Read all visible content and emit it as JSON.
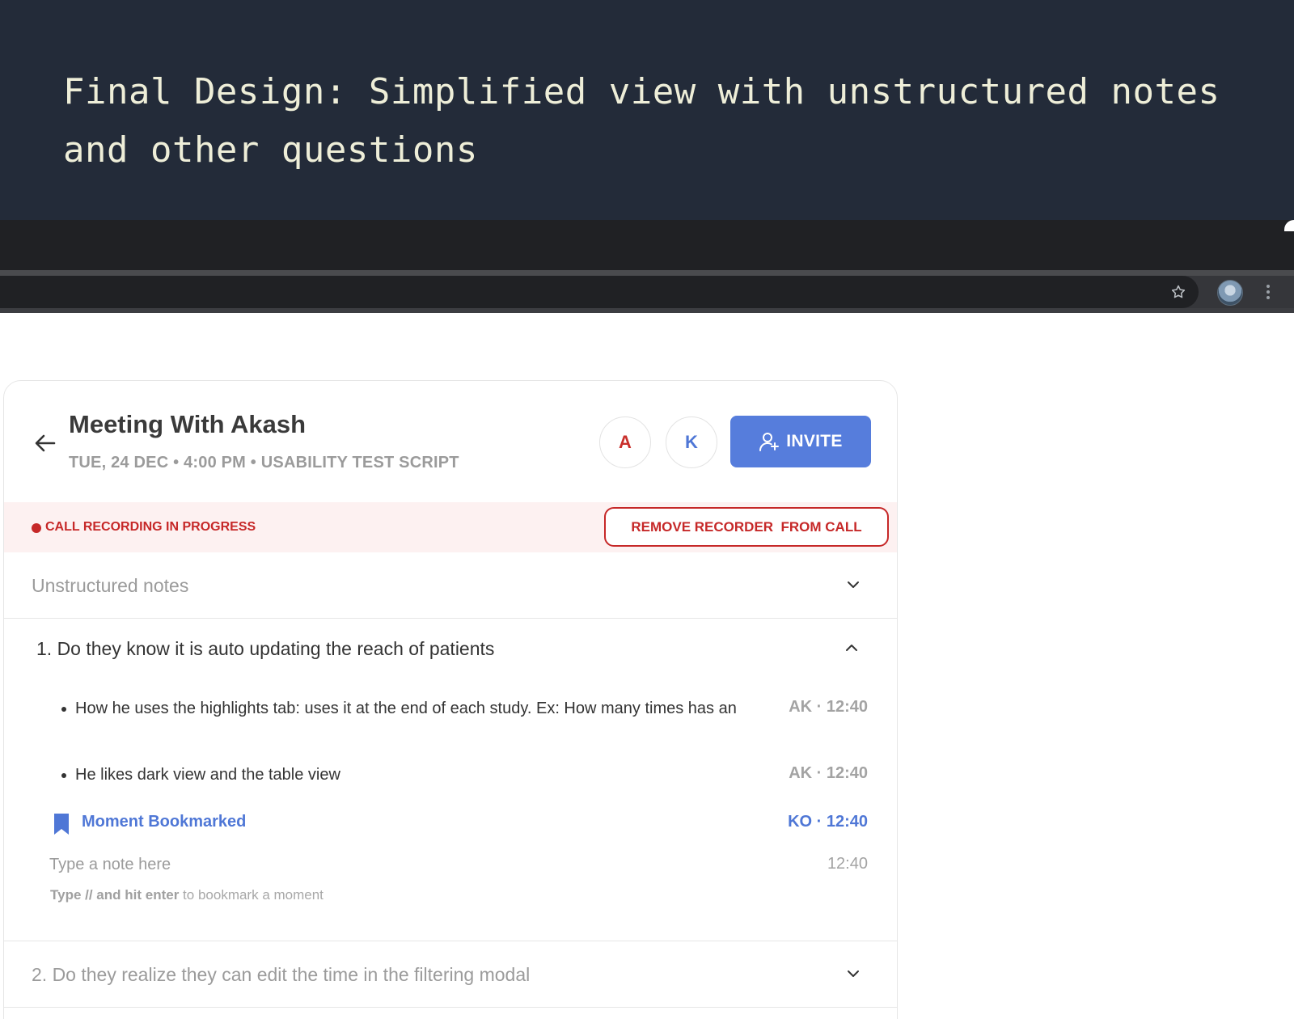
{
  "banner": {
    "title": "Final Design: Simplified view with unstructured notes and other questions"
  },
  "browser": {
    "icons": [
      "star-icon",
      "profile-avatar",
      "more-vert-icon"
    ]
  },
  "meeting": {
    "title": "Meeting With Akash",
    "subtitle": "TUE, 24 DEC • 4:00 PM • USABILITY TEST SCRIPT",
    "participants": [
      {
        "initial": "A",
        "color": "#c9302c"
      },
      {
        "initial": "K",
        "color": "#4f77d6"
      }
    ],
    "invite_label": "INVITE"
  },
  "recording": {
    "status": "CALL RECORDING IN PROGRESS",
    "remove_label": "REMOVE RECORDER  FROM CALL"
  },
  "sections": {
    "unstructured": {
      "label": "Unstructured notes"
    },
    "q1": {
      "title": "1. Do they know it is auto updating the reach of patients",
      "notes": [
        {
          "text": "How he uses the highlights tab: uses it at the end of each study. Ex: How many times has an",
          "meta": "AK · 12:40"
        },
        {
          "text": "He likes dark view and the table view",
          "meta": "AK · 12:40"
        }
      ],
      "bookmark": {
        "label": "Moment Bookmarked",
        "meta": "KO · 12:40"
      },
      "input": {
        "placeholder": "Type a note here",
        "time": "12:40"
      },
      "hint": {
        "bold": "Type // and hit enter",
        "rest": " to bookmark a moment"
      }
    },
    "q2": {
      "title": "2. Do they realize they can edit the time in the filtering modal"
    }
  },
  "colors": {
    "banner_bg": "#232b39",
    "accent_blue": "#567ddc",
    "recording_red": "#c62828",
    "recording_bg": "#fdf1f1"
  }
}
